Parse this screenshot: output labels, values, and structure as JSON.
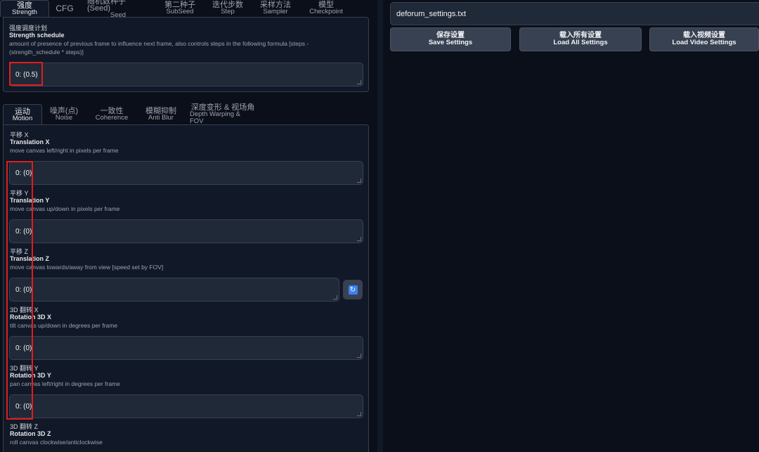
{
  "top_tabs": [
    {
      "zh": "强度",
      "en": "Strength"
    },
    {
      "zh": "",
      "en": "CFG"
    },
    {
      "zh": "随机数种子 (Seed)",
      "en": "Seed"
    },
    {
      "zh": "第二种子",
      "en": "SubSeed"
    },
    {
      "zh": "迭代步数",
      "en": "Step"
    },
    {
      "zh": "采样方法",
      "en": "Sampler"
    },
    {
      "zh": "模型",
      "en": "Checkpoint"
    }
  ],
  "strength": {
    "label_zh": "强度调度计划",
    "label_en": "Strength schedule",
    "desc_line1": "amount of presence of previous frame to influence next frame, also controls steps in the following formula [steps -",
    "desc_line2": "(strength_schedule * steps)]",
    "value": "0: (0.5)"
  },
  "motion_tabs": [
    {
      "zh": "运动",
      "en": "Motion"
    },
    {
      "zh": "噪声(点)",
      "en": "Noise"
    },
    {
      "zh": "一致性",
      "en": "Coherence"
    },
    {
      "zh": "模糊抑制",
      "en": "Anti Blur"
    },
    {
      "zh": "深度变形 & 视场角",
      "en": "Depth Warping & FOV"
    }
  ],
  "fields": {
    "translation_x": {
      "zh": "平移 X",
      "en": "Translation X",
      "desc": "move canvas left/right in pixels per frame",
      "value": "0: (0)"
    },
    "translation_y": {
      "zh": "平移 Y",
      "en": "Translation Y",
      "desc": "move canvas up/down in pixels per frame",
      "value": "0: (0)"
    },
    "translation_z": {
      "zh": "平移 Z",
      "en": "Translation Z",
      "desc": "move canvas towards/away from view [speed set by FOV]",
      "value": "0: (0)"
    },
    "rotation_3d_x": {
      "zh": "3D 翻转 X",
      "en": "Rotation 3D X",
      "desc": "tilt canvas up/down in degrees per frame",
      "value": "0: (0)"
    },
    "rotation_3d_y": {
      "zh": "3D 翻转 Y",
      "en": "Rotation 3D Y",
      "desc": "pan canvas left/right in degrees per frame",
      "value": "0: (0)"
    },
    "rotation_3d_z": {
      "zh": "3D 翻转 Z",
      "en": "Rotation 3D Z",
      "desc": "roll canvas clockwise/anticlockwise"
    }
  },
  "right": {
    "filename": "deforum_settings.txt",
    "buttons": [
      {
        "zh": "保存设置",
        "en": "Save Settings"
      },
      {
        "zh": "载入所有设置",
        "en": "Load All Settings"
      },
      {
        "zh": "载入视频设置",
        "en": "Load Video Settings"
      }
    ]
  },
  "icons": {
    "refresh": "refresh-icon"
  },
  "colors": {
    "highlight": "#e11d1d",
    "accent": "#3b82f6",
    "background": "#0b0f19",
    "panel": "#111827"
  }
}
